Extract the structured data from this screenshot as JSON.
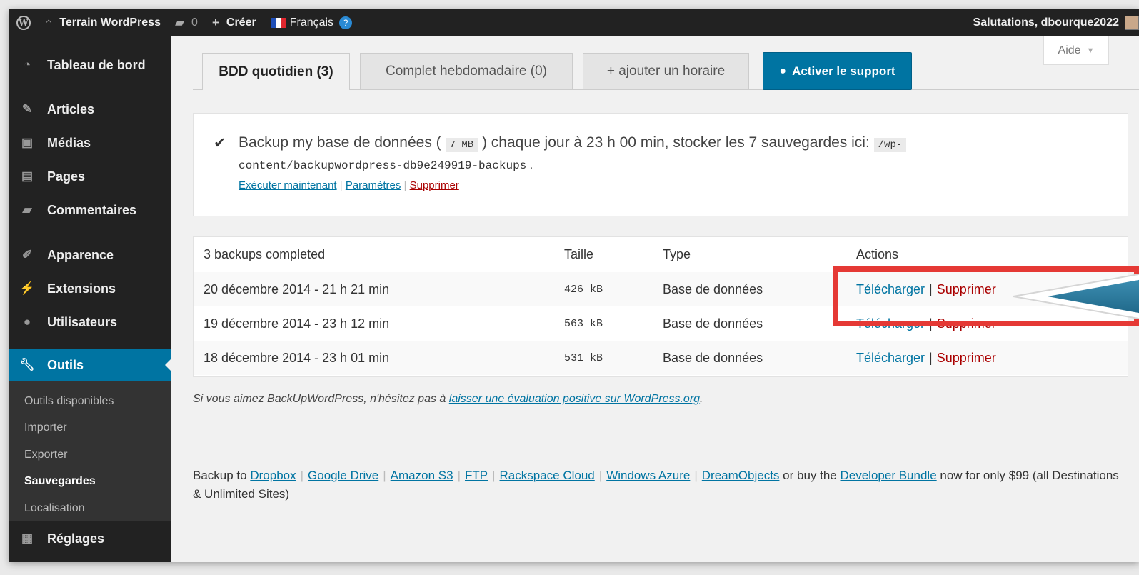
{
  "adminbar": {
    "site_name": "Terrain WordPress",
    "comments_count": "0",
    "new_label": "Créer",
    "language": "Français",
    "greeting": "Salutations, dbourque2022"
  },
  "sidebar": {
    "items": [
      {
        "label": "Tableau de bord",
        "icon": "dashboard-icon"
      },
      {
        "label": "Articles",
        "icon": "pin-icon"
      },
      {
        "label": "Médias",
        "icon": "media-icon"
      },
      {
        "label": "Pages",
        "icon": "pages-icon"
      },
      {
        "label": "Commentaires",
        "icon": "comment-icon"
      },
      {
        "label": "Apparence",
        "icon": "brush-icon"
      },
      {
        "label": "Extensions",
        "icon": "plugin-icon"
      },
      {
        "label": "Utilisateurs",
        "icon": "user-icon"
      },
      {
        "label": "Outils",
        "icon": "wrench-icon"
      },
      {
        "label": "Réglages",
        "icon": "settings-icon"
      }
    ],
    "submenu": [
      "Outils disponibles",
      "Importer",
      "Exporter",
      "Sauvegardes",
      "Localisation"
    ]
  },
  "help_tab": "Aide",
  "tabs": {
    "daily": "BDD quotidien (3)",
    "weekly": "Complet hebdomadaire (0)",
    "add": "+ ajouter un horaire",
    "support": "Activer le support"
  },
  "schedule": {
    "text_1": "Backup my base de données (",
    "size": "7 MB",
    "text_2": ") chaque jour à",
    "time": "23 h 00 min",
    "text_3": ", stocker les 7 sauvegardes ici:",
    "path_1": "/wp-",
    "path_2": "content/backupwordpress-db9e249919-backups",
    "text_4": ".",
    "run_now": "Exécuter maintenant",
    "settings": "Paramètres",
    "delete": "Supprimer"
  },
  "table": {
    "headers": {
      "date": "3 backups completed",
      "size": "Taille",
      "type": "Type",
      "actions": "Actions"
    },
    "rows": [
      {
        "date": "20 décembre 2014 - 21 h 21 min",
        "size": "426 kB",
        "type": "Base de données",
        "download": "Télécharger",
        "delete": "Supprimer"
      },
      {
        "date": "19 décembre 2014 - 23 h 12 min",
        "size": "563 kB",
        "type": "Base de données",
        "download": "Télécharger",
        "delete": "Supprimer"
      },
      {
        "date": "18 décembre 2014 - 23 h 01 min",
        "size": "531 kB",
        "type": "Base de données",
        "download": "Télécharger",
        "delete": "Supprimer"
      }
    ]
  },
  "review": {
    "text": "Si vous aimez BackUpWordPress, n'hésitez pas à",
    "link": "laisser une évaluation positive sur WordPress.org",
    "end": "."
  },
  "destinations": {
    "prefix": "Backup to",
    "links": [
      "Dropbox",
      "Google Drive",
      "Amazon S3",
      "FTP",
      "Rackspace Cloud",
      "Windows Azure",
      "DreamObjects"
    ],
    "middle": "or buy the",
    "bundle": "Developer Bundle",
    "suffix": "now for only $99 (all Destinations & Unlimited Sites)"
  },
  "colors": {
    "accent": "#0074a2",
    "danger": "#aa0000",
    "highlight": "#e53935",
    "arrow": "#2b7a9e"
  }
}
